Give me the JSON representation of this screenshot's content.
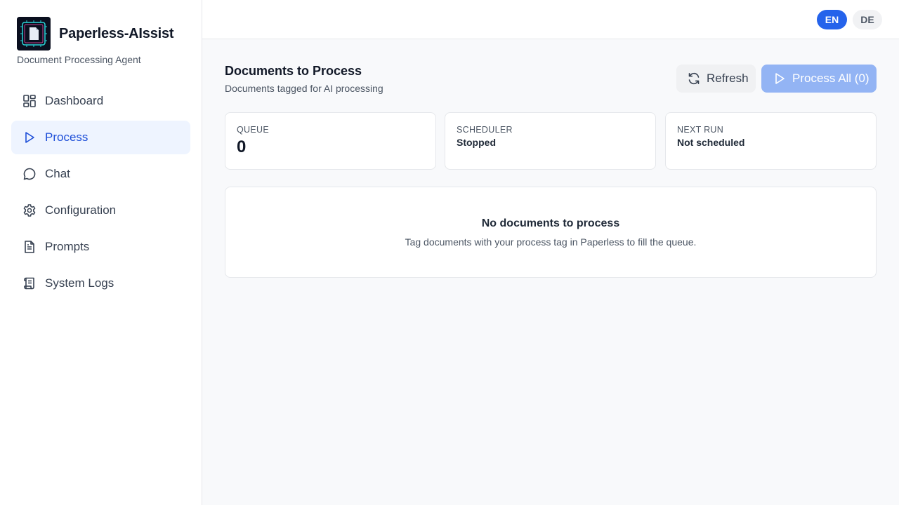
{
  "brand": {
    "name": "Paperless-AIssist",
    "subtitle": "Document Processing Agent"
  },
  "sidebar": {
    "items": [
      {
        "label": "Dashboard",
        "icon": "dashboard-icon",
        "active": false
      },
      {
        "label": "Process",
        "icon": "play-icon",
        "active": true
      },
      {
        "label": "Chat",
        "icon": "chat-bubble-icon",
        "active": false
      },
      {
        "label": "Configuration",
        "icon": "gear-icon",
        "active": false
      },
      {
        "label": "Prompts",
        "icon": "document-text-icon",
        "active": false
      },
      {
        "label": "System Logs",
        "icon": "scroll-icon",
        "active": false
      }
    ]
  },
  "header": {
    "languages": [
      {
        "code": "EN",
        "selected": true
      },
      {
        "code": "DE",
        "selected": false
      }
    ]
  },
  "main": {
    "title": "Documents to Process",
    "subtitle": "Documents tagged for AI processing",
    "refresh_label": "Refresh",
    "process_all_label": "Process All (0)",
    "stats": {
      "queue": {
        "label": "QUEUE",
        "value": "0"
      },
      "scheduler": {
        "label": "SCHEDULER",
        "value": "Stopped"
      },
      "next_run": {
        "label": "NEXT RUN",
        "value": "Not scheduled"
      }
    },
    "empty_state": {
      "title": "No documents to process",
      "description": "Tag documents with your process tag in Paperless to fill the queue."
    }
  },
  "colors": {
    "accent": "#2563eb",
    "active_bg": "#eef4ff",
    "disabled_primary": "#93b4f4"
  }
}
